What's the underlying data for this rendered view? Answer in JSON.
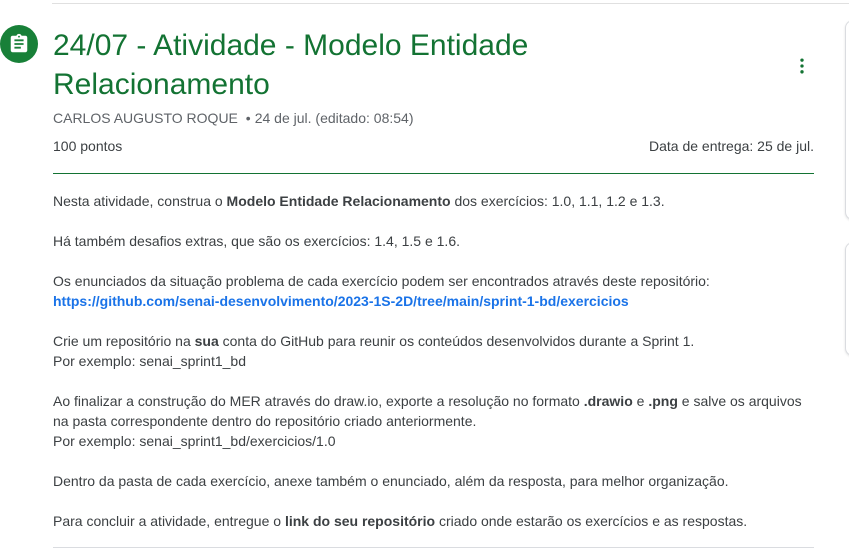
{
  "assignment": {
    "title_line1": "24/07 - Atividade - Modelo Entidade",
    "title_line2": "Relacionamento",
    "author": "CARLOS AUGUSTO ROQUE",
    "separator": "•",
    "date": "24 de jul. (editado: 08:54)",
    "points": "100 pontos",
    "due": "Data de entrega: 25 de jul.",
    "icon": "assignment-icon",
    "menu_icon": "more-vert-icon",
    "accent_color": "#137333"
  },
  "description": {
    "p1_before": "Nesta atividade, construa o ",
    "p1_bold": "Modelo Entidade Relacionamento",
    "p1_after": " dos exercícios: 1.0, 1.1, 1.2 e 1.3.",
    "p2": "Há também desafios extras, que são os exercícios: 1.4, 1.5 e 1.6.",
    "p3_text": "Os enunciados da situação problema de cada exercício podem ser encontrados através deste repositório:",
    "p3_link": "https://github.com/senai-desenvolvimento/2023-1S-2D/tree/main/sprint-1-bd/exercicios",
    "p4_before": "Crie um repositório na ",
    "p4_bold": "sua",
    "p4_after": " conta do GitHub para reunir os conteúdos desenvolvidos durante a Sprint 1.",
    "p4_example": "Por exemplo: senai_sprint1_bd",
    "p5_before": "Ao finalizar a construção do MER através do draw.io, exporte a resolução no formato ",
    "p5_bold1": ".drawio",
    "p5_mid": " e ",
    "p5_bold2": ".png",
    "p5_after": " e salve os arquivos na pasta correspondente dentro do repositório criado anteriormente.",
    "p5_example": "Por exemplo: senai_sprint1_bd/exercicios/1.0",
    "p6": "Dentro da pasta de cada exercício, anexe também o enunciado, além da resposta, para melhor organização.",
    "p7_before": "Para concluir a atividade, entregue o ",
    "p7_bold": "link do seu repositório",
    "p7_after": " criado onde estarão os exercícios e as respostas."
  }
}
